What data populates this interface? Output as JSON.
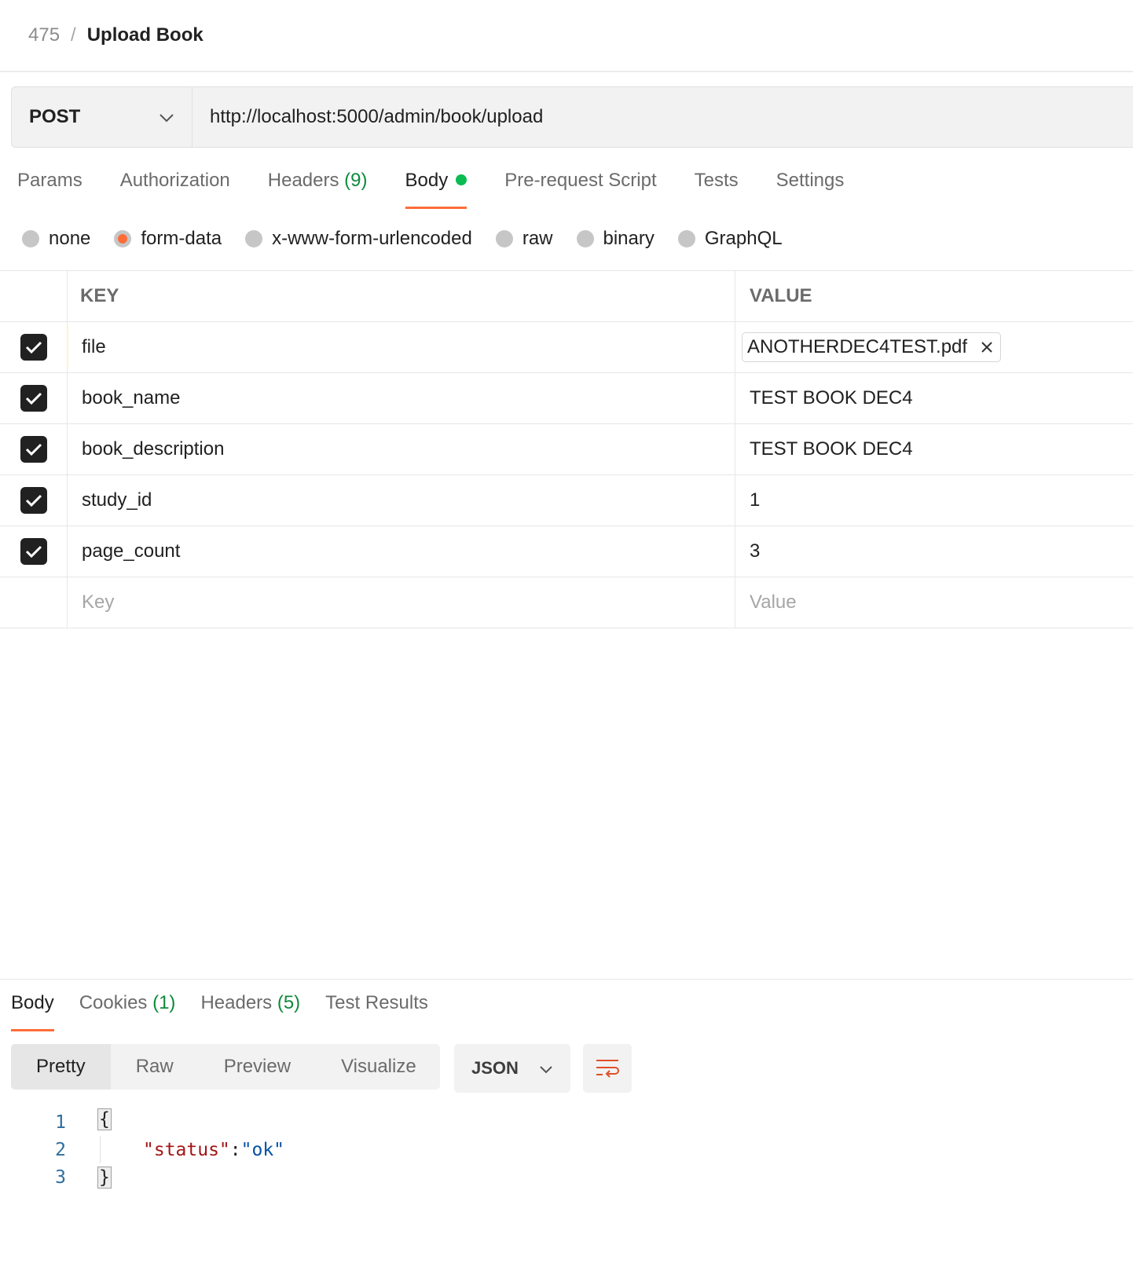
{
  "breadcrumb": {
    "parent": "475",
    "separator": "/",
    "title": "Upload Book"
  },
  "request": {
    "method": "POST",
    "url": "http://localhost:5000/admin/book/upload"
  },
  "request_tabs": [
    {
      "label": "Params",
      "count": ""
    },
    {
      "label": "Authorization",
      "count": ""
    },
    {
      "label": "Headers",
      "count": "(9)"
    },
    {
      "label": "Body",
      "count": "",
      "active": true
    },
    {
      "label": "Pre-request Script",
      "count": ""
    },
    {
      "label": "Tests",
      "count": ""
    },
    {
      "label": "Settings",
      "count": ""
    }
  ],
  "body_types": [
    {
      "label": "none",
      "selected": false
    },
    {
      "label": "form-data",
      "selected": true
    },
    {
      "label": "x-www-form-urlencoded",
      "selected": false
    },
    {
      "label": "raw",
      "selected": false
    },
    {
      "label": "binary",
      "selected": false
    },
    {
      "label": "GraphQL",
      "selected": false
    }
  ],
  "form_table": {
    "headers": {
      "key": "KEY",
      "value": "VALUE"
    },
    "rows": [
      {
        "key": "file",
        "value": "ANOTHERDEC4TEST.pdf",
        "checked": true,
        "is_file": true
      },
      {
        "key": "book_name",
        "value": "TEST BOOK DEC4",
        "checked": true
      },
      {
        "key": "book_description",
        "value": "TEST BOOK DEC4",
        "checked": true
      },
      {
        "key": "study_id",
        "value": "1",
        "checked": true
      },
      {
        "key": "page_count",
        "value": "3",
        "checked": true
      }
    ],
    "placeholder": {
      "key": "Key",
      "value": "Value"
    }
  },
  "response_tabs": [
    {
      "label": "Body",
      "count": "",
      "active": true
    },
    {
      "label": "Cookies",
      "count": "(1)"
    },
    {
      "label": "Headers",
      "count": "(5)"
    },
    {
      "label": "Test Results",
      "count": ""
    }
  ],
  "view_modes": [
    "Pretty",
    "Raw",
    "Preview",
    "Visualize"
  ],
  "format": "JSON",
  "code": {
    "line_numbers": [
      "1",
      "2",
      "3"
    ],
    "open_brace": "{",
    "key": "\"status\"",
    "colon": ": ",
    "value": "\"ok\"",
    "close_brace": "}"
  },
  "colors": {
    "accent": "#ff6c37",
    "green": "#0cbb52",
    "count_green": "#0f8a3c"
  },
  "icons": {
    "method_dropdown": "chevron-down-icon",
    "remove_file": "close-icon",
    "wrap": "wrap-lines-icon",
    "checkbox": "check-icon"
  }
}
